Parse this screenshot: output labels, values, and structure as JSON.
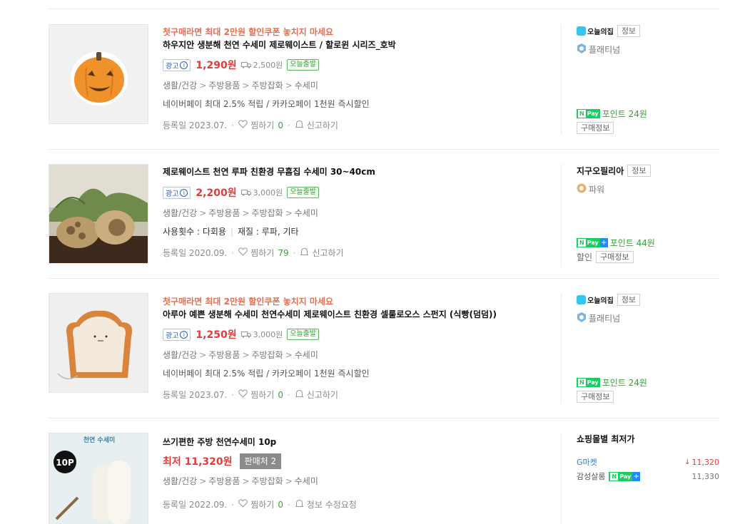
{
  "products": [
    {
      "promo": "첫구매라면 최대 2만원 할인쿠폰 놓치지 마세요",
      "title": "하우지안 생분해 천연 수세미 제로웨이스트 / 할로윈 시리즈_호박",
      "ad_label": "광고",
      "ad_info": "i",
      "price": "1,290원",
      "shipping": "2,500원",
      "today_ship": "오늘출발",
      "categories": [
        "생활/건강",
        "주방용품",
        "주방잡화",
        "수세미"
      ],
      "desc": "네이버페이 최대 2.5% 적립 / 카카오페이 1천원 즉시할인",
      "reg_date": "등록일 2023.07.",
      "wish_label": "찜하기",
      "wish_count": "0",
      "report_label": "신고하기",
      "mall_logo": "오늘의집",
      "info_btn": "정보",
      "grade": "플래티넘",
      "npay_point": "포인트 24원",
      "buy_info": "구매정보"
    },
    {
      "title": "제로웨이스트 천연 루파 친환경 무흠집 수세미 30~40cm",
      "ad_label": "광고",
      "ad_info": "i",
      "price": "2,200원",
      "shipping": "3,000원",
      "today_ship": "오늘출발",
      "categories": [
        "생활/건강",
        "주방용품",
        "주방잡화",
        "수세미"
      ],
      "attr1": "사용횟수 : 다회용",
      "attr2": "재질 : 루파, 기타",
      "reg_date": "등록일 2020.09.",
      "wish_label": "찜하기",
      "wish_count": "79",
      "report_label": "신고하기",
      "mall_name": "지구오필리아",
      "info_btn": "정보",
      "grade": "파워",
      "npay_point": "포인트 44원",
      "discount": "할인",
      "buy_info": "구매정보"
    },
    {
      "promo": "첫구매라면 최대 2만원 할인쿠폰 놓치지 마세요",
      "title": "아루아 예쁜 생분해 수세미 천연수세미 제로웨이스트 친환경 셀룰로오스 스펀지 (식빵(덤덤))",
      "ad_label": "광고",
      "ad_info": "i",
      "price": "1,250원",
      "shipping": "3,000원",
      "today_ship": "오늘출발",
      "categories": [
        "생활/건강",
        "주방용품",
        "주방잡화",
        "수세미"
      ],
      "desc": "네이버페이 최대 2.5% 적립 / 카카오페이 1천원 즉시할인",
      "reg_date": "등록일 2023.07.",
      "wish_label": "찜하기",
      "wish_count": "0",
      "report_label": "신고하기",
      "mall_logo": "오늘의집",
      "info_btn": "정보",
      "grade": "플래티넘",
      "npay_point": "포인트 24원",
      "buy_info": "구매정보"
    },
    {
      "title": "쓰기편한 주방 천연수세미 10p",
      "low_price": "최저 11,320원",
      "sellers": "판매처 2",
      "categories": [
        "생활/건강",
        "주방용품",
        "주방잡화",
        "수세미"
      ],
      "reg_date": "등록일 2022.09.",
      "wish_label": "찜하기",
      "wish_count": "0",
      "edit_label": "정보 수정요청",
      "img_label": "천연 수세미",
      "img_badge": "10P",
      "lowest_title": "쇼핑몰별 최저가",
      "shops": [
        {
          "name": "G마켓",
          "price": "11,320"
        },
        {
          "name": "감성살롱",
          "price": "11,330"
        }
      ]
    }
  ],
  "colors": {
    "price_red": "#e03c3c",
    "promo_orange": "#e56f52",
    "green": "#3e9e3e",
    "npay": "#19ce60"
  },
  "npay_label": "Pay",
  "npay_n": "N",
  "gt": ">",
  "dot": "·",
  "bar": "|"
}
